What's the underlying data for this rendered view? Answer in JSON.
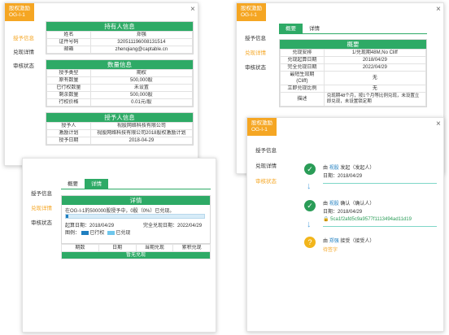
{
  "colors": {
    "brand_orange": "#f5a623",
    "section_green": "#2eaa66",
    "link_blue": "#1f7fc0",
    "check_green": "#2a9c57",
    "pending_yellow": "#f2b51b"
  },
  "tag": {
    "line1": "股权激励",
    "line2": "OG-I-1"
  },
  "close_label": "×",
  "nav": {
    "grant": "授予信息",
    "redeem": "兑现详情",
    "review": "审核状态"
  },
  "tabs": {
    "overview": "概要",
    "detail": "详情"
  },
  "holder": {
    "title": "持有人信息",
    "rows": [
      {
        "k": "姓名",
        "v": "郑强"
      },
      {
        "k": "证件号码",
        "v": "320511196008131514"
      },
      {
        "k": "邮箱",
        "v": "zhenqiang@captable.cn"
      }
    ]
  },
  "quantity": {
    "title": "数量信息",
    "rows": [
      {
        "k": "授予类型",
        "v": "期权"
      },
      {
        "k": "原有数量",
        "v": "500,000股"
      },
      {
        "k": "已行权数量",
        "v": "未设置"
      },
      {
        "k": "剩余数量",
        "v": "500,000股"
      },
      {
        "k": "行权价格",
        "v": "0.01元/股"
      }
    ]
  },
  "grantor": {
    "title": "授予人信息",
    "rows": [
      {
        "k": "授予人",
        "v": "视股网络科技有限公司"
      },
      {
        "k": "激励计划",
        "v": "视股网络科技有限公司2018股权激励计划"
      },
      {
        "k": "授予日期",
        "v": "2018-04-29"
      }
    ]
  },
  "overview": {
    "title": "概要",
    "rows": [
      {
        "k": "兑现安排",
        "v": "1/兑现期48M,No Cliff"
      },
      {
        "k": "兑现起算日期",
        "v": "2018/04/29"
      },
      {
        "k": "完全兑现日期",
        "v": "2022/04/29"
      },
      {
        "k": "最短生效期\n(Cliff)",
        "v": "无"
      },
      {
        "k": "立即兑现比例",
        "v": "无"
      },
      {
        "k": "描述",
        "v": "兑现期48个月，按1个月等比例兑现，未设置立即兑现，未设置锁定期"
      }
    ]
  },
  "detail": {
    "title": "详情",
    "summary": "在OG-I-1的500000股授予中，0股（0%）已兑现。",
    "progress": 0.02,
    "start": "起算日期：2018/04/29",
    "end": "完全兑现日期：2022/04/29",
    "legend_label": "图例：",
    "legend_exercised": "已行权",
    "legend_vested": "已兑现",
    "columns": [
      "期数",
      "日期",
      "当期兑现",
      "累积兑现"
    ],
    "empty": "暂无兑现"
  },
  "review": {
    "steps": [
      {
        "prefix": "由",
        "who": "视股",
        "action": "发起（发起人）",
        "date": "日期：2018/04/29",
        "status": "done"
      },
      {
        "prefix": "由",
        "who": "视股",
        "action": "确认（确认人）",
        "date": "日期：2018/04/29",
        "hash": "5ca1f2afd5c9a9577f1113494ad11d19",
        "status": "done"
      },
      {
        "prefix": "由",
        "who": "郑强",
        "action": "接受（接受人）",
        "name": "待签字",
        "status": "pending"
      }
    ]
  }
}
